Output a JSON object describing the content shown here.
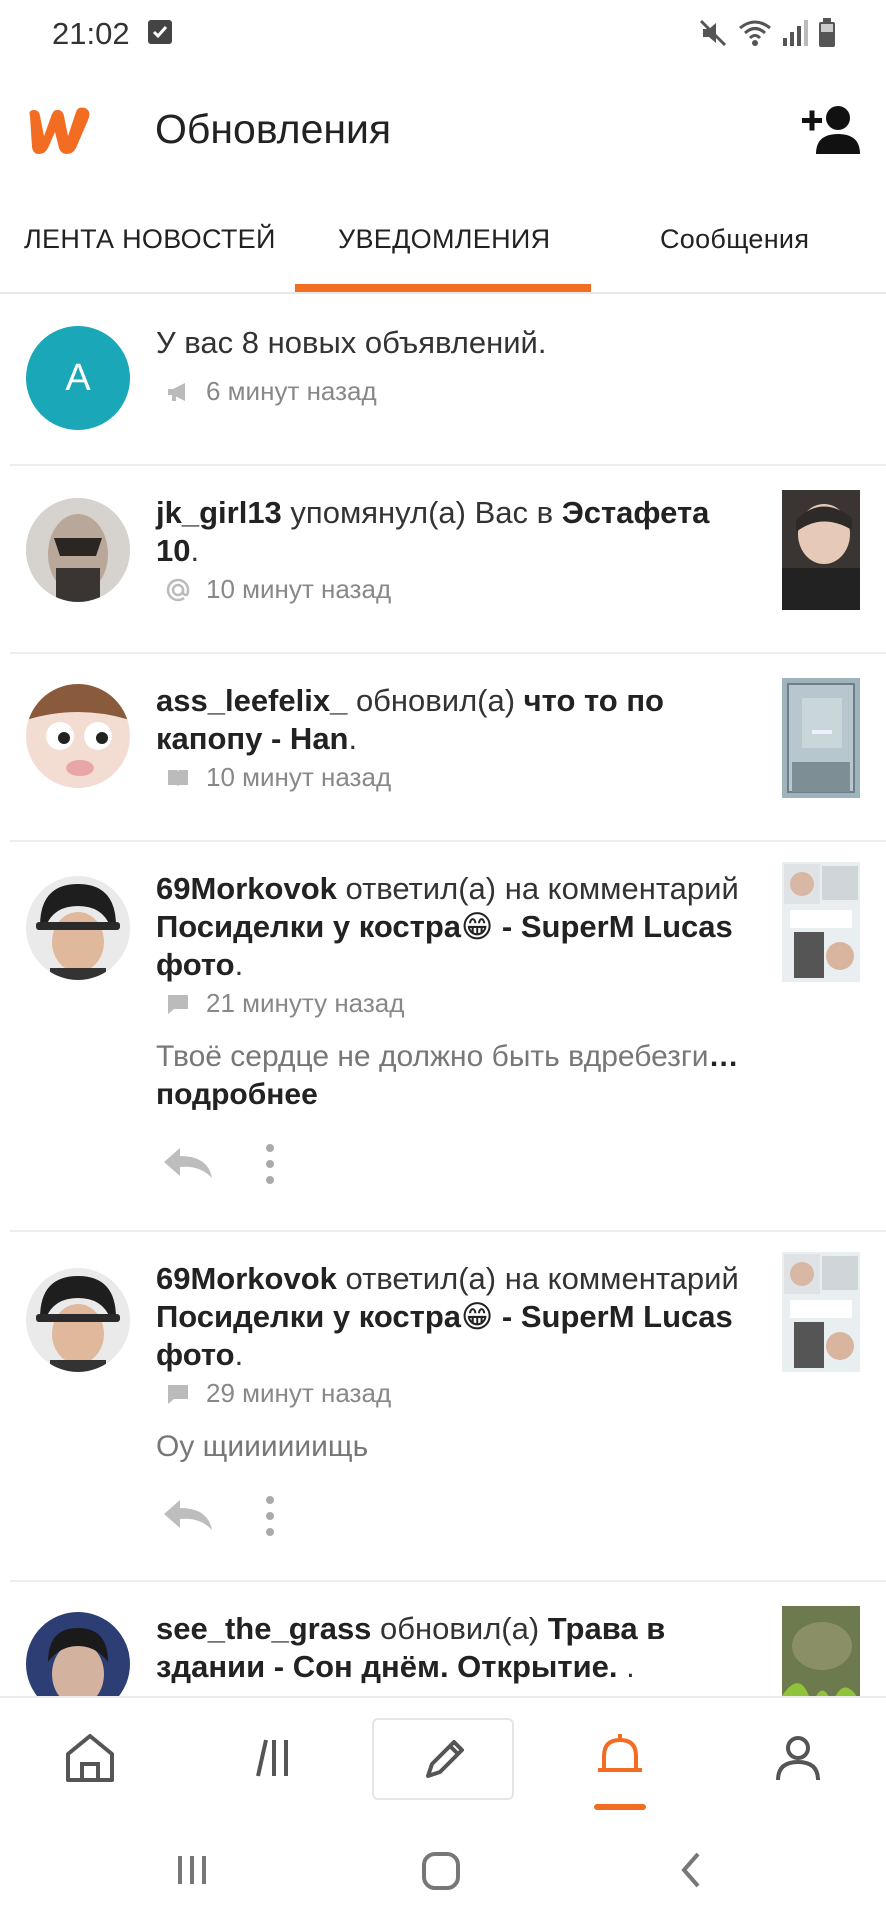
{
  "status_bar": {
    "time": "21:02"
  },
  "header": {
    "title": "Обновления"
  },
  "tabs": [
    {
      "label": "ЛЕНТА НОВОСТЕЙ",
      "active": false
    },
    {
      "label": "УВЕДОМЛЕНИЯ",
      "active": true
    },
    {
      "label": "Сообщения",
      "active": false
    }
  ],
  "colors": {
    "accent": "#f26d21",
    "avatar_a": "#1aa7b8"
  },
  "notifications": [
    {
      "avatar_letter": "A",
      "text": "У вас 8 новых объявлений.",
      "meta_icon": "megaphone-icon",
      "time": "6 минут назад"
    },
    {
      "user": "jk_girl13",
      "action": " упомянул(а) Вас в ",
      "target": "Эстафета 10",
      "suffix": ".",
      "meta_icon": "at-icon",
      "time": "10 минут назад"
    },
    {
      "user": "ass_leefelix_",
      "action": " обновил(а) ",
      "target": "что то по капопу - Han",
      "suffix": ".",
      "meta_icon": "book-icon",
      "time": "10 минут назад"
    },
    {
      "user": "69Morkovok",
      "action": " ответил(а) на комментарий ",
      "target": "Посиделки у костра😁 - SuperM Lucas фото",
      "suffix": ".",
      "meta_icon": "comment-icon",
      "time": "21 минуту назад",
      "comment": "Твоё сердце не должно быть вдребезги",
      "more": "… подробнее"
    },
    {
      "user": "69Morkovok",
      "action": " ответил(а) на комментарий ",
      "target": "Посиделки у костра😁 - SuperM Lucas фото",
      "suffix": ".",
      "meta_icon": "comment-icon",
      "time": "29 минут назад",
      "comment": "Оу щиииииищь"
    },
    {
      "user": "see_the_grass",
      "action": " обновил(а) ",
      "target": "Трава в здании - Сон днём. Открытие.",
      "suffix": " ."
    }
  ],
  "bottom_nav": [
    {
      "icon": "home-icon"
    },
    {
      "icon": "library-icon"
    },
    {
      "icon": "pencil-icon"
    },
    {
      "icon": "bell-icon",
      "active": true
    },
    {
      "icon": "profile-icon"
    }
  ]
}
